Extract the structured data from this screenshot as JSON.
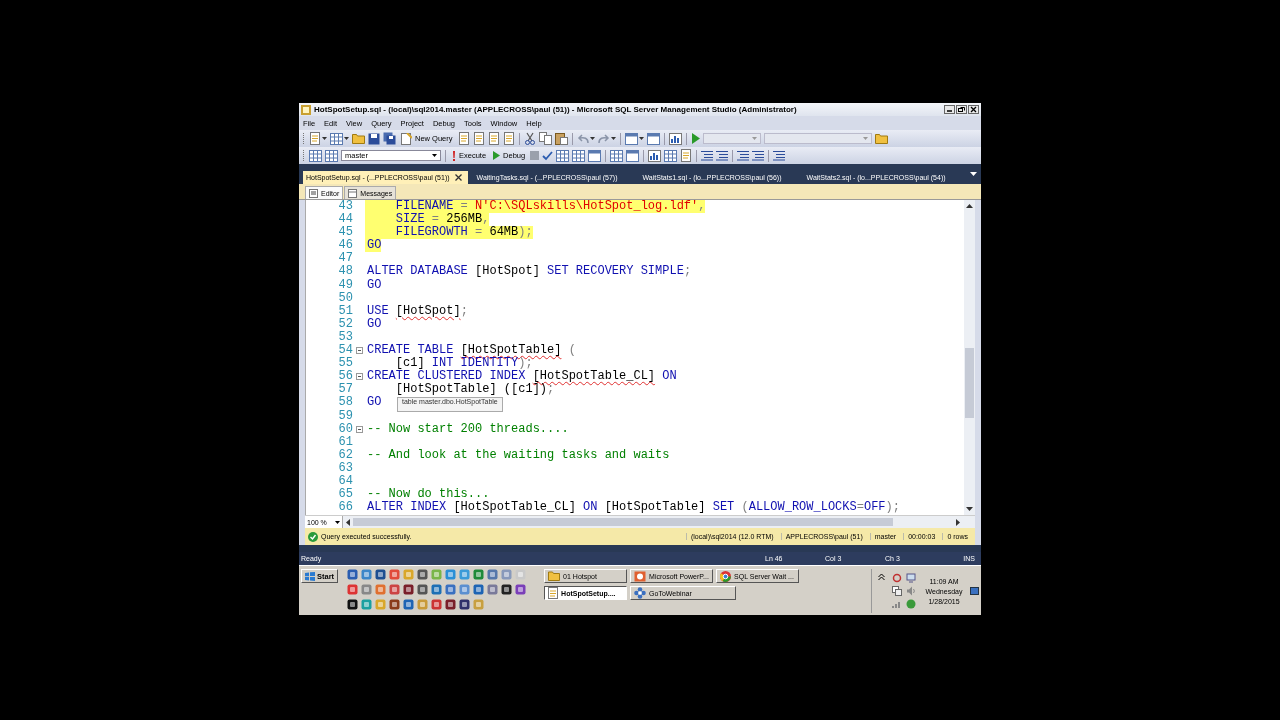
{
  "window": {
    "title": "HotSpotSetup.sql - (local)\\sql2014.master (APPLECROSS\\paul (51)) - Microsoft SQL Server Management Studio (Administrator)"
  },
  "menu": [
    "File",
    "Edit",
    "View",
    "Query",
    "Project",
    "Debug",
    "Tools",
    "Window",
    "Help"
  ],
  "toolbar": {
    "new_query": "New Query",
    "database": "master",
    "execute": "Execute",
    "debug": "Debug"
  },
  "document_tabs": [
    {
      "label": "HotSpotSetup.sql - (...PPLECROSS\\paul (51))",
      "selected": true
    },
    {
      "label": "WaitingTasks.sql - (...PPLECROSS\\paul (57))",
      "selected": false
    },
    {
      "label": "WaitStats1.sql - (lo...PPLECROSS\\paul (56))",
      "selected": false
    },
    {
      "label": "WaitStats2.sql - (lo...PPLECROSS\\paul (54))",
      "selected": false
    }
  ],
  "editor_tabs": [
    {
      "label": "Editor",
      "selected": true
    },
    {
      "label": "Messages",
      "selected": false
    }
  ],
  "code_lines": [
    {
      "number": "43",
      "highlighted": true,
      "fold_marker": false,
      "tokens": [
        {
          "kind": "keyword",
          "text": "    FILENAME"
        },
        {
          "kind": "punct",
          "text": " = "
        },
        {
          "kind": "string",
          "text": "N'C:\\SQLskills\\HotSpot_log.ldf'"
        },
        {
          "kind": "punct",
          "text": ","
        }
      ]
    },
    {
      "number": "44",
      "highlighted": true,
      "fold_marker": false,
      "tokens": [
        {
          "kind": "keyword",
          "text": "    SIZE"
        },
        {
          "kind": "punct",
          "text": " = "
        },
        {
          "kind": "plain",
          "text": "256MB"
        },
        {
          "kind": "punct",
          "text": ","
        }
      ]
    },
    {
      "number": "45",
      "highlighted": true,
      "fold_marker": false,
      "tokens": [
        {
          "kind": "keyword",
          "text": "    FILEGROWTH"
        },
        {
          "kind": "punct",
          "text": " = "
        },
        {
          "kind": "plain",
          "text": "64MB"
        },
        {
          "kind": "punct",
          "text": ");"
        }
      ]
    },
    {
      "number": "46",
      "highlighted": true,
      "fold_marker": false,
      "tokens": [
        {
          "kind": "keyword",
          "text": "GO"
        }
      ]
    },
    {
      "number": "47",
      "fold_marker": false
    },
    {
      "number": "48",
      "highlighted": false,
      "fold_marker": false,
      "tokens": [
        {
          "kind": "keyword",
          "text": "ALTER DATABASE "
        },
        {
          "kind": "plain",
          "text": "[HotSpot]"
        },
        {
          "kind": "keyword",
          "text": " SET RECOVERY SIMPLE"
        },
        {
          "kind": "punct",
          "text": ";"
        }
      ]
    },
    {
      "number": "49",
      "highlighted": false,
      "fold_marker": false,
      "tokens": [
        {
          "kind": "keyword",
          "text": "GO"
        }
      ]
    },
    {
      "number": "50",
      "fold_marker": false
    },
    {
      "number": "51",
      "highlighted": false,
      "fold_marker": false,
      "tokens": [
        {
          "kind": "keyword",
          "text": "USE "
        },
        {
          "kind": "plain",
          "text": "[HotSpot]",
          "squiggle": true
        },
        {
          "kind": "punct",
          "text": ";"
        }
      ]
    },
    {
      "number": "52",
      "highlighted": false,
      "fold_marker": false,
      "tokens": [
        {
          "kind": "keyword",
          "text": "GO"
        }
      ]
    },
    {
      "number": "53",
      "fold_marker": false
    },
    {
      "number": "54",
      "highlighted": false,
      "fold_marker": true,
      "tokens": [
        {
          "kind": "keyword",
          "text": "CREATE TABLE "
        },
        {
          "kind": "plain",
          "text": "[HotSpotTable]",
          "squiggle": true
        },
        {
          "kind": "punct",
          "text": " ("
        }
      ]
    },
    {
      "number": "55",
      "highlighted": false,
      "fold_marker": false,
      "tokens": [
        {
          "kind": "plain",
          "text": "    [c1] "
        },
        {
          "kind": "keyword",
          "text": "INT IDENTITY"
        },
        {
          "kind": "punct",
          "text": ");"
        }
      ]
    },
    {
      "number": "56",
      "highlighted": false,
      "fold_marker": true,
      "tokens": [
        {
          "kind": "keyword",
          "text": "CREATE CLUSTERED INDEX "
        },
        {
          "kind": "plain",
          "text": "[HotSpotTable_CL]",
          "squiggle": true
        },
        {
          "kind": "keyword",
          "text": " ON"
        }
      ]
    },
    {
      "number": "57",
      "highlighted": false,
      "fold_marker": false,
      "tokens": [
        {
          "kind": "plain",
          "text": "    [HotSpotTable] ([c1])"
        },
        {
          "kind": "punct",
          "text": ";"
        }
      ]
    },
    {
      "number": "58",
      "highlighted": false,
      "fold_marker": false,
      "tokens": [
        {
          "kind": "keyword",
          "text": "GO"
        }
      ],
      "tooltip": "table master.dbo.HotSpotTable"
    },
    {
      "number": "59",
      "fold_marker": false
    },
    {
      "number": "60",
      "highlighted": false,
      "fold_marker": true,
      "tokens": [
        {
          "kind": "comment",
          "text": "-- Now start 200 threads...."
        }
      ]
    },
    {
      "number": "61",
      "fold_marker": false
    },
    {
      "number": "62",
      "highlighted": false,
      "fold_marker": false,
      "tokens": [
        {
          "kind": "comment",
          "text": "-- And look at the waiting tasks and waits"
        }
      ]
    },
    {
      "number": "63",
      "fold_marker": false
    },
    {
      "number": "64",
      "fold_marker": false
    },
    {
      "number": "65",
      "highlighted": false,
      "fold_marker": false,
      "tokens": [
        {
          "kind": "comment",
          "text": "-- Now do this..."
        }
      ]
    },
    {
      "number": "66",
      "highlighted": false,
      "fold_marker": false,
      "tokens": [
        {
          "kind": "keyword",
          "text": "ALTER INDEX "
        },
        {
          "kind": "plain",
          "text": "[HotSpotTable_CL]"
        },
        {
          "kind": "keyword",
          "text": " ON "
        },
        {
          "kind": "plain",
          "text": "[HotSpotTable]"
        },
        {
          "kind": "keyword",
          "text": " SET "
        },
        {
          "kind": "punct",
          "text": "("
        },
        {
          "kind": "keyword",
          "text": "ALLOW_ROW_LOCKS"
        },
        {
          "kind": "punct",
          "text": "="
        },
        {
          "kind": "keyword",
          "text": "OFF"
        },
        {
          "kind": "punct",
          "text": ");"
        }
      ]
    }
  ],
  "zoom": "100 %",
  "query_status": {
    "message": "Query executed successfully.",
    "server": "(local)\\sql2014 (12.0 RTM)",
    "user": "APPLECROSS\\paul (51)",
    "database": "master",
    "elapsed": "00:00:03",
    "rows": "0 rows"
  },
  "status_bar": {
    "state": "Ready",
    "line": "Ln 46",
    "column": "Col 3",
    "character": "Ch 3",
    "mode": "INS"
  },
  "taskbar": {
    "start": "Start",
    "tasks": [
      {
        "label": "01 Hotspot",
        "selected": false,
        "kind": "folder"
      },
      {
        "label": "Microsoft PowerP...",
        "selected": false,
        "kind": "slides"
      },
      {
        "label": "SQL Server Wait ...",
        "selected": false,
        "kind": "browser"
      },
      {
        "label": "HotSpotSetup....",
        "selected": true,
        "kind": "document"
      },
      {
        "label": "GoToWebinar",
        "selected": false,
        "kind": "flower"
      }
    ],
    "clock": {
      "time": "11:09 AM",
      "day": "Wednesday",
      "date": "1/28/2015"
    }
  }
}
